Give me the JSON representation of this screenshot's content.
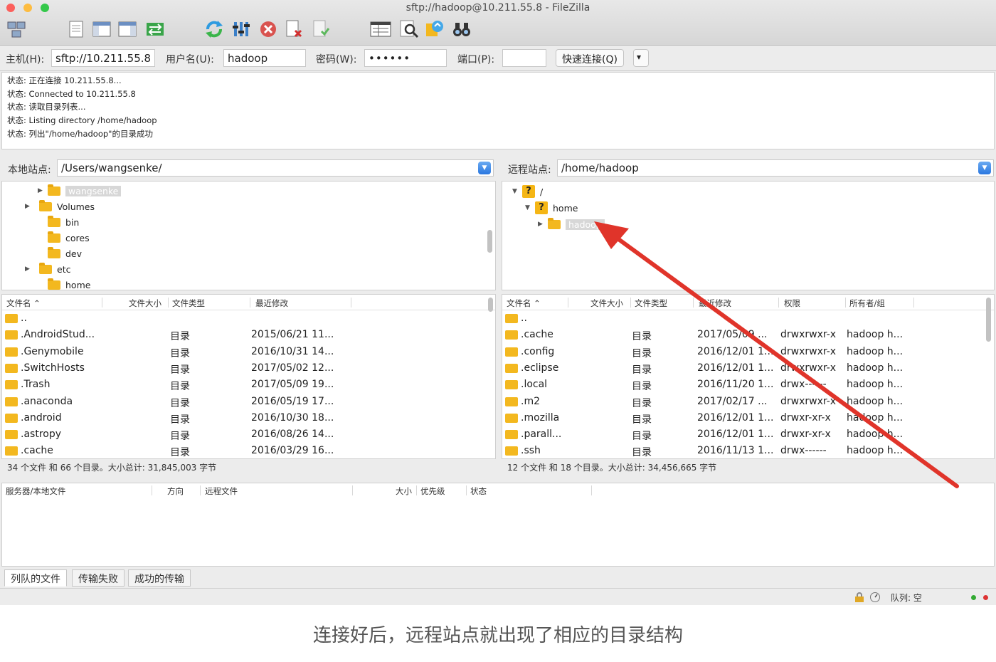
{
  "window": {
    "title": "sftp://hadoop@10.211.55.8 - FileZilla"
  },
  "toolbar": {
    "icons": [
      "site-manager-icon",
      "message-log-icon",
      "local-tree-icon",
      "remote-tree-icon",
      "transfer-queue-icon",
      "refresh-icon",
      "filter-icon",
      "cancel-icon",
      "disconnect-icon",
      "reconnect-icon",
      "directory-listing-icon",
      "search-files-icon",
      "sync-browse-icon",
      "binoculars-icon"
    ]
  },
  "quickconnect": {
    "host_label": "主机(H):",
    "host_value": "sftp://10.211.55.8",
    "user_label": "用户名(U):",
    "user_value": "hadoop",
    "pass_label": "密码(W):",
    "pass_value": "••••••",
    "port_label": "端口(P):",
    "port_value": "",
    "connect_label": "快速连接(Q)",
    "history_label": "▾"
  },
  "log": [
    "状态:  正在连接 10.211.55.8...",
    "状态:  Connected to 10.211.55.8",
    "状态:  读取目录列表...",
    "状态:  Listing directory /home/hadoop",
    "状态:  列出\"/home/hadoop\"的目录成功"
  ],
  "local": {
    "site_label": "本地站点:",
    "path": "/Users/wangsenke/",
    "tree": [
      {
        "name": "wangsenke",
        "expander": "▶",
        "selected": true
      },
      {
        "name": "Volumes",
        "expander": "▶",
        "selected": false
      },
      {
        "name": "bin",
        "expander": "",
        "selected": false
      },
      {
        "name": "cores",
        "expander": "",
        "selected": false
      },
      {
        "name": "dev",
        "expander": "",
        "selected": false
      },
      {
        "name": "etc",
        "expander": "▶",
        "selected": false
      },
      {
        "name": "home",
        "expander": "",
        "selected": false
      }
    ],
    "headers": [
      "文件名  ⌃",
      "文件大小",
      "文件类型",
      "最近修改"
    ],
    "files": [
      {
        "name": "..",
        "type": "",
        "modified": ""
      },
      {
        "name": ".AndroidStud...",
        "type": "目录",
        "modified": "2015/06/21 11..."
      },
      {
        "name": ".Genymobile",
        "type": "目录",
        "modified": "2016/10/31 14..."
      },
      {
        "name": ".SwitchHosts",
        "type": "目录",
        "modified": "2017/05/02 12..."
      },
      {
        "name": ".Trash",
        "type": "目录",
        "modified": "2017/05/09 19..."
      },
      {
        "name": ".anaconda",
        "type": "目录",
        "modified": "2016/05/19 17..."
      },
      {
        "name": ".android",
        "type": "目录",
        "modified": "2016/10/30 18..."
      },
      {
        "name": ".astropy",
        "type": "目录",
        "modified": "2016/08/26 14..."
      },
      {
        "name": ".cache",
        "type": "目录",
        "modified": "2016/03/29 16..."
      }
    ],
    "status": "34 个文件 和 66 个目录。大小总计: 31,845,003 字节"
  },
  "remote": {
    "site_label": "远程站点:",
    "path": "/home/hadoop",
    "tree": [
      {
        "name": "/",
        "expander": "▼",
        "unknown": true
      },
      {
        "name": "home",
        "expander": "▼",
        "unknown": true
      },
      {
        "name": "hadoop",
        "expander": "▶",
        "selected": true
      }
    ],
    "headers": [
      "文件名  ⌃",
      "文件大小",
      "文件类型",
      "最近修改",
      "权限",
      "所有者/组"
    ],
    "files": [
      {
        "name": "..",
        "type": "",
        "modified": "",
        "perms": "",
        "owner": ""
      },
      {
        "name": ".cache",
        "type": "目录",
        "modified": "2017/05/09 ...",
        "perms": "drwxrwxr-x",
        "owner": "hadoop h..."
      },
      {
        "name": ".config",
        "type": "目录",
        "modified": "2016/12/01 1...",
        "perms": "drwxrwxr-x",
        "owner": "hadoop h..."
      },
      {
        "name": ".eclipse",
        "type": "目录",
        "modified": "2016/12/01 1...",
        "perms": "drwxrwxr-x",
        "owner": "hadoop h..."
      },
      {
        "name": ".local",
        "type": "目录",
        "modified": "2016/11/20 1...",
        "perms": "drwx------",
        "owner": "hadoop h..."
      },
      {
        "name": ".m2",
        "type": "目录",
        "modified": "2017/02/17 ...",
        "perms": "drwxrwxr-x",
        "owner": "hadoop h..."
      },
      {
        "name": ".mozilla",
        "type": "目录",
        "modified": "2016/12/01 1...",
        "perms": "drwxr-xr-x",
        "owner": "hadoop h..."
      },
      {
        "name": ".parall...",
        "type": "目录",
        "modified": "2016/12/01 1...",
        "perms": "drwxr-xr-x",
        "owner": "hadoop h..."
      },
      {
        "name": ".ssh",
        "type": "目录",
        "modified": "2016/11/13 1...",
        "perms": "drwx------",
        "owner": "hadoop h..."
      }
    ],
    "status": "12 个文件 和 18 个目录。大小总计: 34,456,665 字节"
  },
  "queue": {
    "headers": [
      "服务器/本地文件",
      "方向",
      "远程文件",
      "大小",
      "优先级",
      "状态"
    ],
    "tabs": [
      "列队的文件",
      "传输失败",
      "成功的传输"
    ]
  },
  "statusbar": {
    "queue_text": "队列: 空"
  },
  "caption": "连接好后，远程站点就出现了相应的目录结构",
  "colors": {
    "accent": "#2a77e0",
    "folder": "#f3b81f",
    "arrow": "#e0342a"
  }
}
